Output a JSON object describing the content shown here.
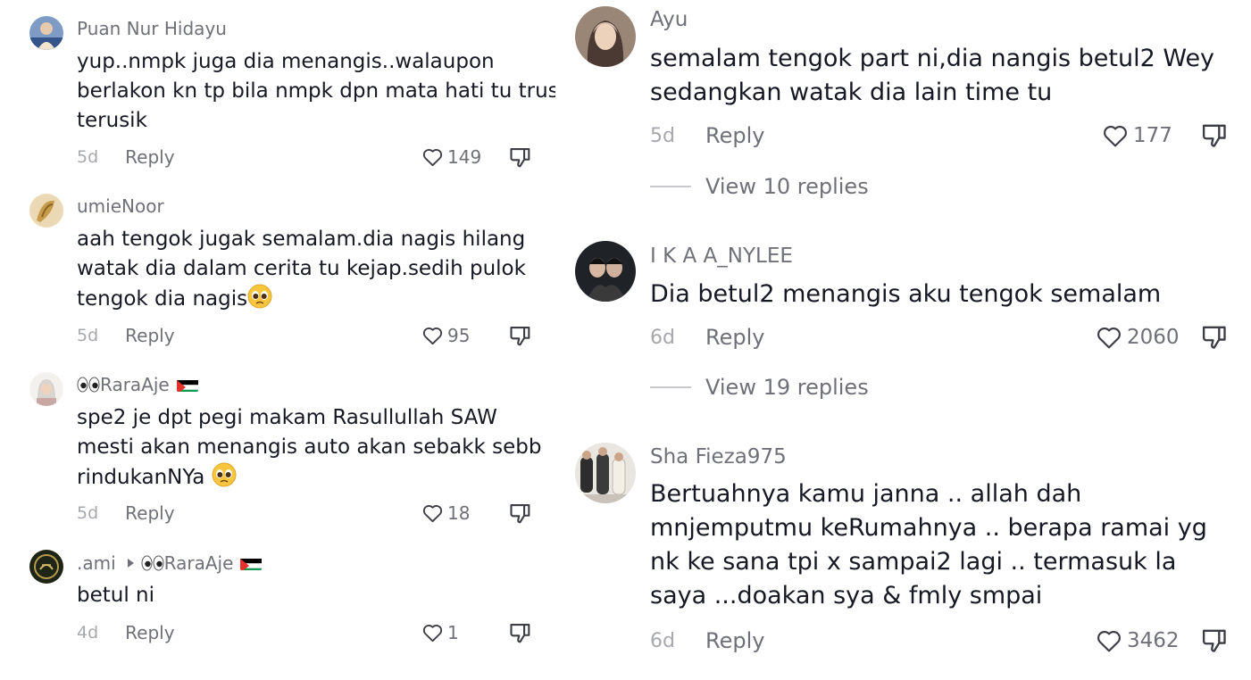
{
  "left_comments": [
    {
      "username": "Puan Nur Hidayu",
      "text": "yup..nmpk juga dia menangis..walaupon berlakon kn tp bila nmpk dpn mata hati tu trus terusik",
      "date": "5d",
      "reply_label": "Reply",
      "likes": "149"
    },
    {
      "username": "umieNoor",
      "text": "aah tengok jugak semalam.dia nagis hilang watak dia dalam cerita tu kejap.sedih pulok tengok dia nagis",
      "emoji": "pleading-face",
      "date": "5d",
      "reply_label": "Reply",
      "likes": "95"
    },
    {
      "username": "RaraAje",
      "username_prefix_emoji": "eyes",
      "flag": "palestine-flag",
      "text": "spe2 je dpt pegi makam Rasullullah SAW mesti akan menangis auto akan sebakk sebb rindukanNYa",
      "emoji": "pleading-face",
      "date": "5d",
      "reply_label": "Reply",
      "likes": "18"
    },
    {
      "username": ".ami",
      "reply_to": "RaraAje",
      "reply_to_prefix_emoji": "eyes",
      "flag": "palestine-flag",
      "text": "betul ni",
      "date": "4d",
      "reply_label": "Reply",
      "likes": "1"
    }
  ],
  "right_comments": [
    {
      "username": "Ayu",
      "text": "semalam tengok part ni,dia nangis betul2 Wey sedangkan watak dia lain time tu",
      "date": "5d",
      "reply_label": "Reply",
      "likes": "177",
      "view_replies": "View 10 replies"
    },
    {
      "username": "I K A A_NYLEE",
      "text": "Dia betul2 menangis aku tengok semalam",
      "date": "6d",
      "reply_label": "Reply",
      "likes": "2060",
      "view_replies": "View 19 replies"
    },
    {
      "username": "Sha Fieza975",
      "text": "Bertuahnya kamu janna .. allah dah mnjemputmu keRumahnya .. berapa ramai yg nk ke sana tpi x sampai2 lagi .. termasuk la saya ...doakan sya & fmly smpai",
      "date": "6d",
      "reply_label": "Reply",
      "likes": "3462"
    }
  ],
  "icons": {
    "like": "heart-outline-icon",
    "dislike": "thumbs-down-icon",
    "reply_arrow": "caret-right-icon"
  },
  "colors": {
    "text_primary": "#161823",
    "text_secondary": "#6f7078",
    "text_muted": "#a7a8ad",
    "background": "#ffffff"
  }
}
